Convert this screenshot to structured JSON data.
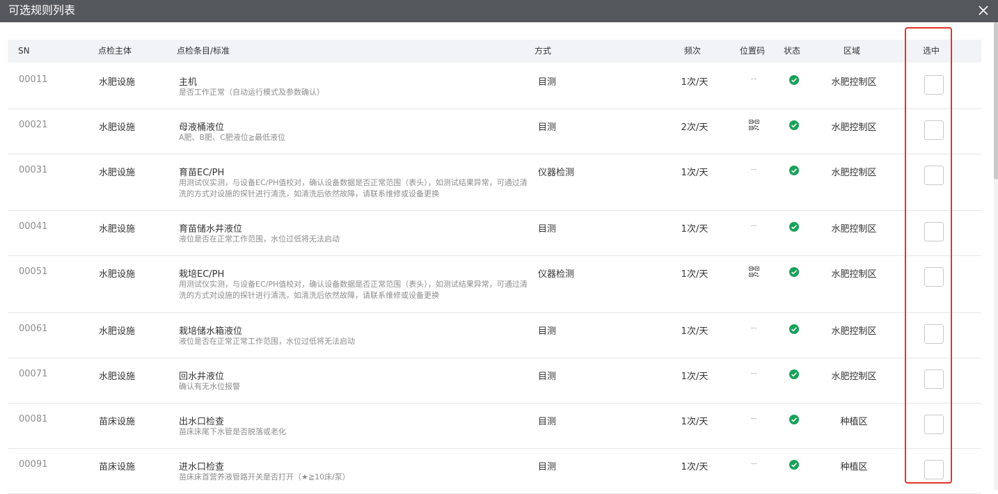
{
  "dialog": {
    "title": "可选规则列表",
    "close_icon": "close-icon"
  },
  "columns": {
    "sn": "SN",
    "subject": "点检主体",
    "item": "点检条目/标准",
    "method": "方式",
    "frequency": "频次",
    "position_code": "位置码",
    "status": "状态",
    "area": "区域",
    "selected": "选中"
  },
  "colors": {
    "titlebar": "#54575c",
    "status_ok": "#19a05a",
    "highlight_box": "#e5332a",
    "header_bg": "#f1f3f6"
  },
  "rows": [
    {
      "sn": "00011",
      "subject": "水肥设施",
      "title": "主机",
      "desc": "是否工作正常（自动运行模式及参数确认）",
      "method": "目测",
      "freq": "1次/天",
      "pos": "--",
      "qr": false,
      "status": "ok",
      "area": "水肥控制区",
      "checked": false
    },
    {
      "sn": "00021",
      "subject": "水肥设施",
      "title": "母液桶液位",
      "desc": "A肥、B肥、C肥液位≧最低液位",
      "method": "目测",
      "freq": "2次/天",
      "pos": "",
      "qr": true,
      "status": "ok",
      "area": "水肥控制区",
      "checked": false
    },
    {
      "sn": "00031",
      "subject": "水肥设施",
      "title": "育苗EC/PH",
      "desc": "用测试仪实测，与设备EC/PH值校对，确认设备数据是否正常范围（表头），如测试结果异常，可通过清洗的方式对设施的探针进行清洗，如清洗后依然故障，请联系维修或设备更换",
      "method": "仪器检测",
      "freq": "1次/天",
      "pos": "--",
      "qr": false,
      "status": "ok",
      "area": "水肥控制区",
      "checked": false
    },
    {
      "sn": "00041",
      "subject": "水肥设施",
      "title": "育苗储水井液位",
      "desc": "液位是否在正常工作范围，水位过低将无法启动",
      "method": "目测",
      "freq": "1次/天",
      "pos": "--",
      "qr": false,
      "status": "ok",
      "area": "水肥控制区",
      "checked": false
    },
    {
      "sn": "00051",
      "subject": "水肥设施",
      "title": "栽培EC/PH",
      "desc": "用测试仪实测，与设备EC/PH值校对，确认设备数据是否正常范围（表头），如测试结果异常，可通过清洗的方式对设施的探针进行清洗，如清洗后依然故障，请联系维修或设备更换",
      "method": "仪器检测",
      "freq": "1次/天",
      "pos": "",
      "qr": true,
      "status": "ok",
      "area": "水肥控制区",
      "checked": false
    },
    {
      "sn": "00061",
      "subject": "水肥设施",
      "title": "栽培储水箱液位",
      "desc": "液位是否在正常正常工作范围，水位过低将无法启动",
      "method": "目测",
      "freq": "1次/天",
      "pos": "--",
      "qr": false,
      "status": "ok",
      "area": "水肥控制区",
      "checked": false
    },
    {
      "sn": "00071",
      "subject": "水肥设施",
      "title": "回水井液位",
      "desc": "确认有无水位报警",
      "method": "目测",
      "freq": "1次/天",
      "pos": "--",
      "qr": false,
      "status": "ok",
      "area": "水肥控制区",
      "checked": false
    },
    {
      "sn": "00081",
      "subject": "苗床设施",
      "title": "出水口检查",
      "desc": "苗床床尾下水管是否脱落或老化",
      "method": "目测",
      "freq": "1次/天",
      "pos": "--",
      "qr": false,
      "status": "ok",
      "area": "种植区",
      "checked": false
    },
    {
      "sn": "00091",
      "subject": "苗床设施",
      "title": "进水口检查",
      "desc": "苗床床首营养液管路开关是否打开（★≧10床/泵）",
      "method": "目测",
      "freq": "1次/天",
      "pos": "--",
      "qr": false,
      "status": "ok",
      "area": "种植区",
      "checked": false
    }
  ]
}
